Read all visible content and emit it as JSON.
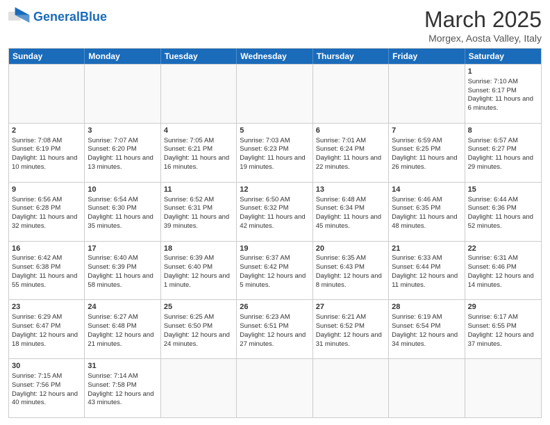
{
  "header": {
    "logo_general": "General",
    "logo_blue": "Blue",
    "month_title": "March 2025",
    "location": "Morgex, Aosta Valley, Italy"
  },
  "days_of_week": [
    "Sunday",
    "Monday",
    "Tuesday",
    "Wednesday",
    "Thursday",
    "Friday",
    "Saturday"
  ],
  "weeks": [
    [
      {
        "day": "",
        "info": ""
      },
      {
        "day": "",
        "info": ""
      },
      {
        "day": "",
        "info": ""
      },
      {
        "day": "",
        "info": ""
      },
      {
        "day": "",
        "info": ""
      },
      {
        "day": "",
        "info": ""
      },
      {
        "day": "1",
        "info": "Sunrise: 7:10 AM\nSunset: 6:17 PM\nDaylight: 11 hours and 6 minutes."
      }
    ],
    [
      {
        "day": "2",
        "info": "Sunrise: 7:08 AM\nSunset: 6:19 PM\nDaylight: 11 hours and 10 minutes."
      },
      {
        "day": "3",
        "info": "Sunrise: 7:07 AM\nSunset: 6:20 PM\nDaylight: 11 hours and 13 minutes."
      },
      {
        "day": "4",
        "info": "Sunrise: 7:05 AM\nSunset: 6:21 PM\nDaylight: 11 hours and 16 minutes."
      },
      {
        "day": "5",
        "info": "Sunrise: 7:03 AM\nSunset: 6:23 PM\nDaylight: 11 hours and 19 minutes."
      },
      {
        "day": "6",
        "info": "Sunrise: 7:01 AM\nSunset: 6:24 PM\nDaylight: 11 hours and 22 minutes."
      },
      {
        "day": "7",
        "info": "Sunrise: 6:59 AM\nSunset: 6:25 PM\nDaylight: 11 hours and 26 minutes."
      },
      {
        "day": "8",
        "info": "Sunrise: 6:57 AM\nSunset: 6:27 PM\nDaylight: 11 hours and 29 minutes."
      }
    ],
    [
      {
        "day": "9",
        "info": "Sunrise: 6:56 AM\nSunset: 6:28 PM\nDaylight: 11 hours and 32 minutes."
      },
      {
        "day": "10",
        "info": "Sunrise: 6:54 AM\nSunset: 6:30 PM\nDaylight: 11 hours and 35 minutes."
      },
      {
        "day": "11",
        "info": "Sunrise: 6:52 AM\nSunset: 6:31 PM\nDaylight: 11 hours and 39 minutes."
      },
      {
        "day": "12",
        "info": "Sunrise: 6:50 AM\nSunset: 6:32 PM\nDaylight: 11 hours and 42 minutes."
      },
      {
        "day": "13",
        "info": "Sunrise: 6:48 AM\nSunset: 6:34 PM\nDaylight: 11 hours and 45 minutes."
      },
      {
        "day": "14",
        "info": "Sunrise: 6:46 AM\nSunset: 6:35 PM\nDaylight: 11 hours and 48 minutes."
      },
      {
        "day": "15",
        "info": "Sunrise: 6:44 AM\nSunset: 6:36 PM\nDaylight: 11 hours and 52 minutes."
      }
    ],
    [
      {
        "day": "16",
        "info": "Sunrise: 6:42 AM\nSunset: 6:38 PM\nDaylight: 11 hours and 55 minutes."
      },
      {
        "day": "17",
        "info": "Sunrise: 6:40 AM\nSunset: 6:39 PM\nDaylight: 11 hours and 58 minutes."
      },
      {
        "day": "18",
        "info": "Sunrise: 6:39 AM\nSunset: 6:40 PM\nDaylight: 12 hours and 1 minute."
      },
      {
        "day": "19",
        "info": "Sunrise: 6:37 AM\nSunset: 6:42 PM\nDaylight: 12 hours and 5 minutes."
      },
      {
        "day": "20",
        "info": "Sunrise: 6:35 AM\nSunset: 6:43 PM\nDaylight: 12 hours and 8 minutes."
      },
      {
        "day": "21",
        "info": "Sunrise: 6:33 AM\nSunset: 6:44 PM\nDaylight: 12 hours and 11 minutes."
      },
      {
        "day": "22",
        "info": "Sunrise: 6:31 AM\nSunset: 6:46 PM\nDaylight: 12 hours and 14 minutes."
      }
    ],
    [
      {
        "day": "23",
        "info": "Sunrise: 6:29 AM\nSunset: 6:47 PM\nDaylight: 12 hours and 18 minutes."
      },
      {
        "day": "24",
        "info": "Sunrise: 6:27 AM\nSunset: 6:48 PM\nDaylight: 12 hours and 21 minutes."
      },
      {
        "day": "25",
        "info": "Sunrise: 6:25 AM\nSunset: 6:50 PM\nDaylight: 12 hours and 24 minutes."
      },
      {
        "day": "26",
        "info": "Sunrise: 6:23 AM\nSunset: 6:51 PM\nDaylight: 12 hours and 27 minutes."
      },
      {
        "day": "27",
        "info": "Sunrise: 6:21 AM\nSunset: 6:52 PM\nDaylight: 12 hours and 31 minutes."
      },
      {
        "day": "28",
        "info": "Sunrise: 6:19 AM\nSunset: 6:54 PM\nDaylight: 12 hours and 34 minutes."
      },
      {
        "day": "29",
        "info": "Sunrise: 6:17 AM\nSunset: 6:55 PM\nDaylight: 12 hours and 37 minutes."
      }
    ],
    [
      {
        "day": "30",
        "info": "Sunrise: 7:15 AM\nSunset: 7:56 PM\nDaylight: 12 hours and 40 minutes."
      },
      {
        "day": "31",
        "info": "Sunrise: 7:14 AM\nSunset: 7:58 PM\nDaylight: 12 hours and 43 minutes."
      },
      {
        "day": "",
        "info": ""
      },
      {
        "day": "",
        "info": ""
      },
      {
        "day": "",
        "info": ""
      },
      {
        "day": "",
        "info": ""
      },
      {
        "day": "",
        "info": ""
      }
    ]
  ]
}
